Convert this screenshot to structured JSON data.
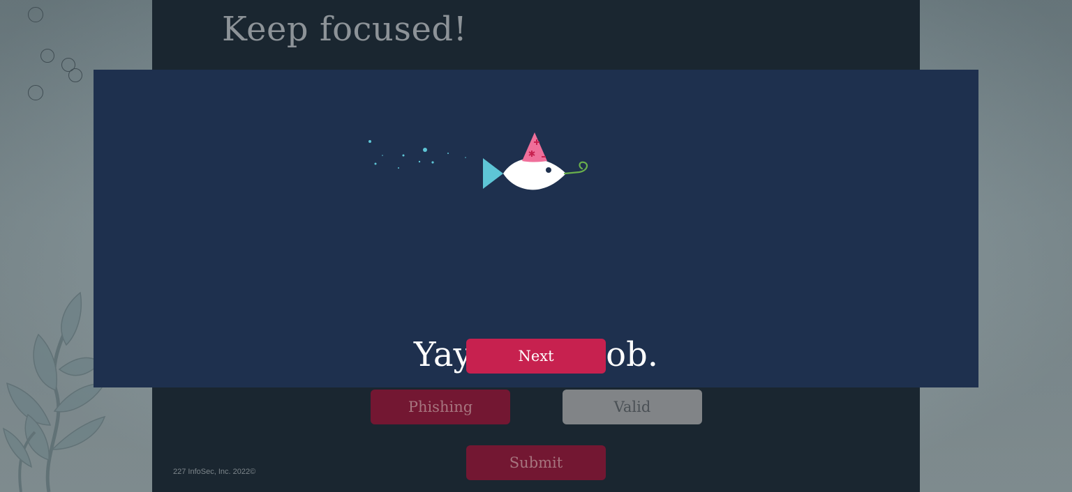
{
  "page": {
    "title": "Keep focused!",
    "copyright": "227 InfoSec, Inc. 2022©"
  },
  "actions": {
    "phishing_label": "Phishing",
    "valid_label": "Valid",
    "submit_label": "Submit"
  },
  "modal": {
    "message": "Yay! Good job.",
    "next_label": "Next",
    "illustration": "party-fish-icon"
  },
  "colors": {
    "panel": "#1a2630",
    "modal": "#1e304e",
    "accent": "#c7214f",
    "accent_dim": "#731732",
    "neutral_button": "#818487",
    "fish_tail": "#5ec5d6",
    "party_hat": "#ef6f9a",
    "party_horn": "#6ab04c"
  }
}
